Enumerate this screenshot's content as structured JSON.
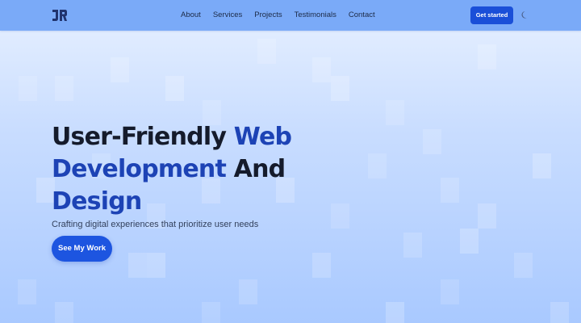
{
  "header": {
    "logo_text": "JR",
    "nav": [
      {
        "label": "About"
      },
      {
        "label": "Services"
      },
      {
        "label": "Projects"
      },
      {
        "label": "Testimonials"
      },
      {
        "label": "Contact"
      }
    ],
    "cta_label": "Get started",
    "theme_icon": "moon-icon"
  },
  "hero": {
    "headline": {
      "part1": "User-Friendly ",
      "part2": "Web Development",
      "part3": " And ",
      "part4": "Design"
    },
    "subtitle": "Crafting digital experiences that prioritize user needs",
    "button_label": "See My Work"
  },
  "colors": {
    "header_bg": "#7aaaf8",
    "accent": "#1d43b5",
    "button": "#1d55e0",
    "text_dark": "#151b2b"
  }
}
